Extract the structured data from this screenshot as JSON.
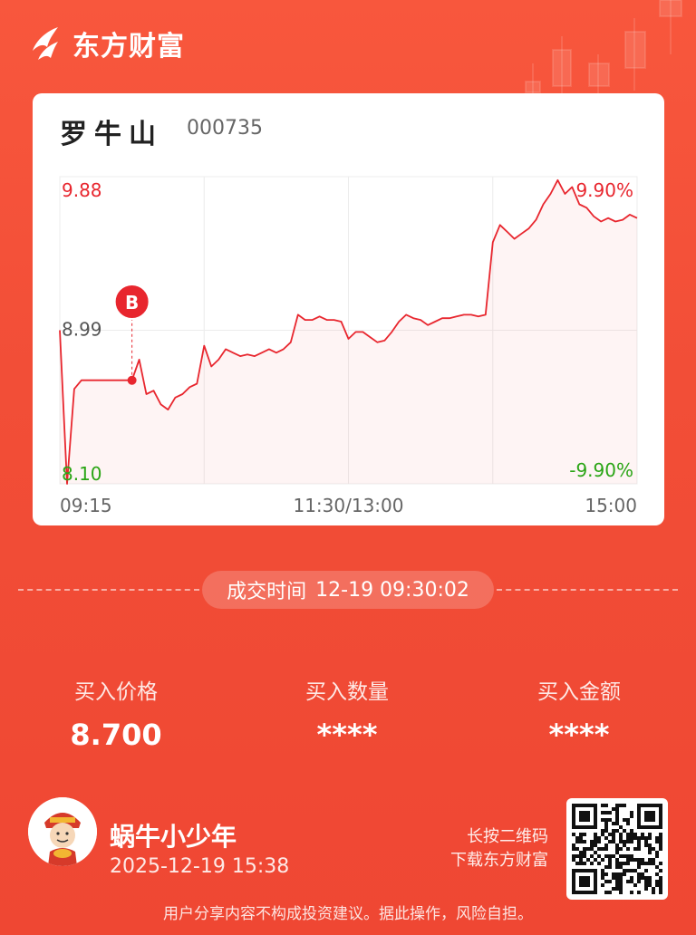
{
  "brand": {
    "name": "东方财富",
    "logo_icon": "eastmoney-logo-icon"
  },
  "stock": {
    "name": "罗牛山",
    "code": "000735"
  },
  "colors": {
    "up": "#e8262e",
    "down": "#2aa515",
    "accent": "#f24e37",
    "marker": "#e8262e"
  },
  "chart_data": {
    "type": "line",
    "y_max_label": "9.88",
    "y_mid_label": "8.99",
    "y_min_label": "8.10",
    "pct_max_label": "9.90%",
    "pct_min_label": "-9.90%",
    "x_labels": [
      "09:15",
      "11:30/13:00",
      "15:00"
    ],
    "ylim": [
      8.1,
      9.88
    ],
    "prev_close": 8.99,
    "grid": true,
    "marker": {
      "label": "B",
      "price": 8.7,
      "time_index": 10
    },
    "series": [
      {
        "values": [
          8.99,
          8.1,
          8.65,
          8.7,
          8.7,
          8.7,
          8.7,
          8.7,
          8.7,
          8.7,
          8.7,
          8.82,
          8.62,
          8.64,
          8.56,
          8.53,
          8.6,
          8.62,
          8.66,
          8.68,
          8.9,
          8.78,
          8.82,
          8.88,
          8.86,
          8.84,
          8.85,
          8.84,
          8.86,
          8.88,
          8.86,
          8.88,
          8.92,
          9.08,
          9.05,
          9.05,
          9.07,
          9.05,
          9.05,
          9.04,
          8.94,
          8.98,
          8.98,
          8.95,
          8.92,
          8.93,
          8.98,
          9.04,
          9.08,
          9.06,
          9.05,
          9.02,
          9.04,
          9.06,
          9.06,
          9.07,
          9.08,
          9.08,
          9.07,
          9.08,
          9.5,
          9.6,
          9.56,
          9.52,
          9.55,
          9.58,
          9.63,
          9.72,
          9.78,
          9.86,
          9.78,
          9.82,
          9.72,
          9.7,
          9.65,
          9.62,
          9.64,
          9.62,
          9.63,
          9.66,
          9.64
        ]
      }
    ]
  },
  "trade": {
    "time_label": "成交时间",
    "time_value": "12-19 09:30:02",
    "price_label": "买入价格",
    "price_value": "8.700",
    "qty_label": "买入数量",
    "qty_value": "****",
    "amount_label": "买入金额",
    "amount_value": "****"
  },
  "user": {
    "name": "蜗牛小少年",
    "time": "2025-12-19 15:38",
    "avatar_icon": "caishen-avatar-icon"
  },
  "qr": {
    "hint_line1": "长按二维码",
    "hint_line2": "下载东方财富",
    "icon": "qr-code-icon"
  },
  "disclaimer": "用户分享内容不构成投资建议。据此操作，风险自担。"
}
